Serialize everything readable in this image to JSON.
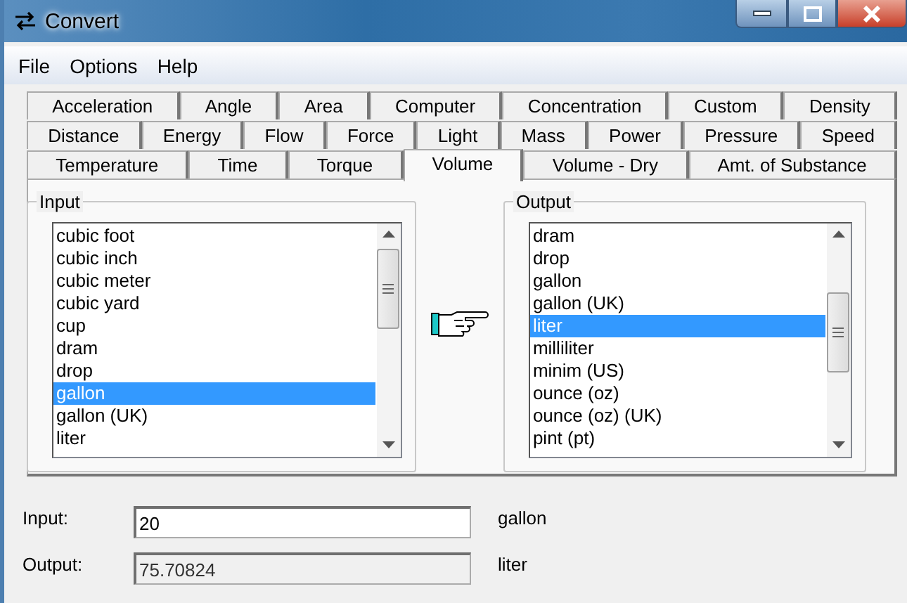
{
  "window": {
    "title": "Convert"
  },
  "menu": [
    "File",
    "Options",
    "Help"
  ],
  "tab_rows": [
    [
      {
        "label": "Acceleration",
        "selected": false
      },
      {
        "label": "Angle",
        "selected": false
      },
      {
        "label": "Area",
        "selected": false
      },
      {
        "label": "Computer",
        "selected": false
      },
      {
        "label": "Concentration",
        "selected": false
      },
      {
        "label": "Custom",
        "selected": false
      },
      {
        "label": "Density",
        "selected": false
      }
    ],
    [
      {
        "label": "Distance",
        "selected": false
      },
      {
        "label": "Energy",
        "selected": false
      },
      {
        "label": "Flow",
        "selected": false
      },
      {
        "label": "Force",
        "selected": false
      },
      {
        "label": "Light",
        "selected": false
      },
      {
        "label": "Mass",
        "selected": false
      },
      {
        "label": "Power",
        "selected": false
      },
      {
        "label": "Pressure",
        "selected": false
      },
      {
        "label": "Speed",
        "selected": false
      }
    ],
    [
      {
        "label": "Temperature",
        "selected": false
      },
      {
        "label": "Time",
        "selected": false
      },
      {
        "label": "Torque",
        "selected": false
      },
      {
        "label": "Volume",
        "selected": true
      },
      {
        "label": "Volume - Dry",
        "selected": false
      },
      {
        "label": "Amt. of Substance",
        "selected": false
      }
    ]
  ],
  "input_group": {
    "title": "Input",
    "items": [
      {
        "label": "cubic foot",
        "selected": false
      },
      {
        "label": "cubic inch",
        "selected": false
      },
      {
        "label": "cubic meter",
        "selected": false
      },
      {
        "label": "cubic yard",
        "selected": false
      },
      {
        "label": "cup",
        "selected": false
      },
      {
        "label": "dram",
        "selected": false
      },
      {
        "label": "drop",
        "selected": false
      },
      {
        "label": "gallon",
        "selected": true
      },
      {
        "label": "gallon (UK)",
        "selected": false
      },
      {
        "label": "liter",
        "selected": false
      }
    ]
  },
  "output_group": {
    "title": "Output",
    "items": [
      {
        "label": "dram",
        "selected": false
      },
      {
        "label": "drop",
        "selected": false
      },
      {
        "label": "gallon",
        "selected": false
      },
      {
        "label": "gallon (UK)",
        "selected": false
      },
      {
        "label": "liter",
        "selected": true
      },
      {
        "label": "milliliter",
        "selected": false
      },
      {
        "label": "minim (US)",
        "selected": false
      },
      {
        "label": "ounce (oz)",
        "selected": false
      },
      {
        "label": "ounce (oz) (UK)",
        "selected": false
      },
      {
        "label": "pint (pt)",
        "selected": false
      }
    ]
  },
  "fields": [
    {
      "label": "Input:",
      "value": "20",
      "unit": "gallon",
      "readonly": false
    },
    {
      "label": "Output:",
      "value": "75.70824",
      "unit": "liter",
      "readonly": true
    }
  ]
}
